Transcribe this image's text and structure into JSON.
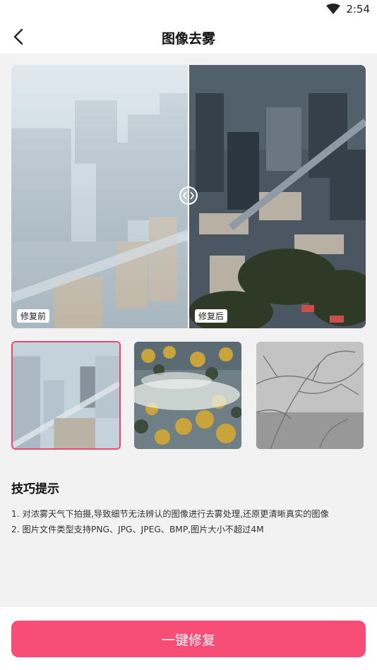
{
  "status_bar": {
    "time": "2:54",
    "wifi_icon": "wifi-icon"
  },
  "header": {
    "title": "图像去雾",
    "back_icon": "chevron-left-icon"
  },
  "compare": {
    "before_label": "修复前",
    "after_label": "修复后",
    "handle_icon": "compare-slider-icon",
    "slider_position": 0.5
  },
  "thumbnails": [
    {
      "name": "hazy-city",
      "selected": true
    },
    {
      "name": "foggy-forest",
      "selected": false
    },
    {
      "name": "foggy-branches",
      "selected": false
    }
  ],
  "tips": {
    "title": "技巧提示",
    "line1": "1. 对浓雾天气下拍摄,导致细节无法辨认的图像进行去雾处理,还原更清晰真实的图像",
    "line2": "2. 图片文件类型支持PNG、JPG、JPEG、BMP,图片大小不超过4M"
  },
  "action": {
    "label": "一键修复"
  },
  "colors": {
    "accent": "#f74d77",
    "selected_border": "#f0456f",
    "background": "#f2f2f2"
  }
}
